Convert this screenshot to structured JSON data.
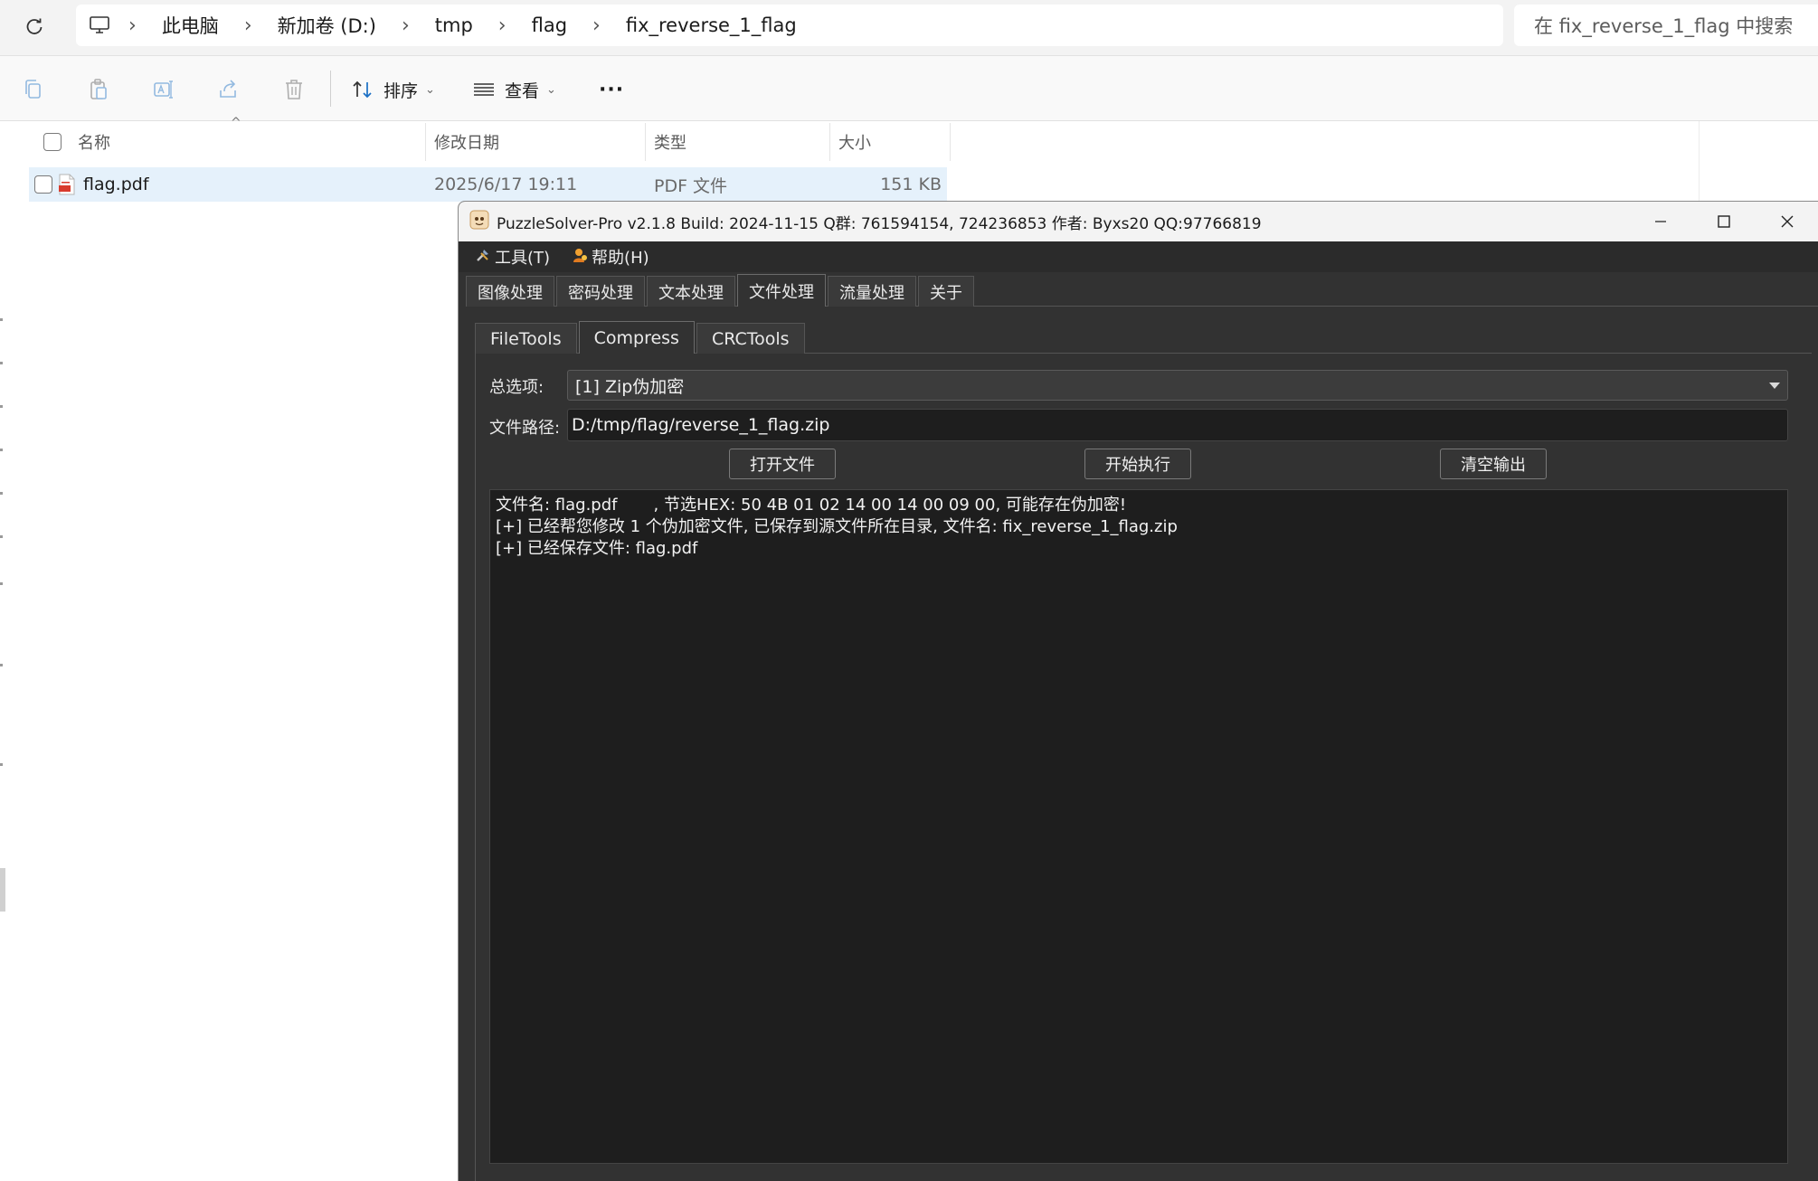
{
  "explorer": {
    "breadcrumb": [
      "此电脑",
      "新加卷 (D:)",
      "tmp",
      "flag",
      "fix_reverse_1_flag"
    ],
    "search_placeholder": "在 fix_reverse_1_flag 中搜索",
    "toolbar": {
      "sort_label": "排序",
      "view_label": "查看",
      "more_label": "···"
    },
    "columns": {
      "name": "名称",
      "modified": "修改日期",
      "type": "类型",
      "size": "大小"
    },
    "files": [
      {
        "name": "flag.pdf",
        "modified": "2025/6/17 19:11",
        "type": "PDF 文件",
        "size": "151 KB"
      }
    ]
  },
  "puzzlesolver": {
    "title": "PuzzleSolver-Pro v2.1.8  Build: 2024-11-15  Q群: 761594154, 724236853  作者: Byxs20  QQ:97766819",
    "menu": {
      "tools": "工具(T)",
      "help": "帮助(H)"
    },
    "main_tabs": [
      "图像处理",
      "密码处理",
      "文本处理",
      "文件处理",
      "流量处理",
      "关于"
    ],
    "active_main_tab": "文件处理",
    "sub_tabs": [
      "FileTools",
      "Compress",
      "CRCTools"
    ],
    "active_sub_tab": "Compress",
    "mode_label": "总选项:",
    "mode_value": "[1] Zip伪加密",
    "path_label": "文件路径:",
    "path_value": "D:/tmp/flag/reverse_1_flag.zip",
    "buttons": {
      "open": "打开文件",
      "run": "开始执行",
      "clear": "清空输出"
    },
    "output_lines": [
      "文件名: flag.pdf       , 节选HEX: 50 4B 01 02 14 00 14 00 09 00, 可能存在伪加密!",
      "[+] 已经帮您修改 1 个伪加密文件, 已保存到源文件所在目录, 文件名: fix_reverse_1_flag.zip",
      "[+] 已经保存文件: flag.pdf"
    ]
  }
}
